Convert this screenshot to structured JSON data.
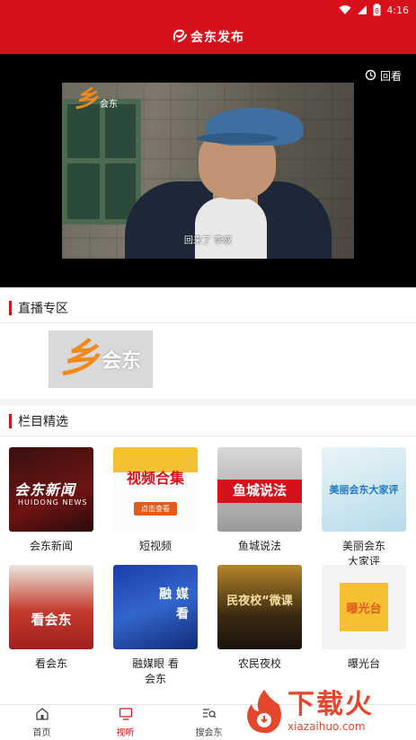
{
  "status_bar": {
    "time": "4:16",
    "battery_level": "8"
  },
  "header": {
    "title": "会东发布"
  },
  "player": {
    "replay_label": "回看",
    "channel_logo_text": "会东",
    "subtitle": "回来了  李叔"
  },
  "live_section": {
    "title": "直播专区",
    "channel_logo_text": "会东"
  },
  "programs_section": {
    "title": "栏目精选",
    "items": [
      {
        "label": "会东新闻",
        "thumb_text": "会东新闻",
        "thumb_sub": "HUIDONG NEWS"
      },
      {
        "label": "短视频",
        "thumb_text": "视频合集",
        "thumb_sub": "点击查看"
      },
      {
        "label": "鱼城说法",
        "thumb_text": "鱼城说法"
      },
      {
        "label": "美丽会东\n大家评",
        "thumb_text": "美丽会东大家评"
      },
      {
        "label": "看会东",
        "thumb_text": "看会东"
      },
      {
        "label": "融媒眼 看\n会东",
        "thumb_text": "融 媒\n看"
      },
      {
        "label": "农民夜校",
        "thumb_text": "民夜校“微课"
      },
      {
        "label": "曝光台",
        "thumb_text": "曝光台"
      }
    ]
  },
  "tab_bar": {
    "tabs": [
      {
        "label": "首页",
        "icon": "home-icon",
        "active": false
      },
      {
        "label": "视听",
        "icon": "tv-icon",
        "active": true
      },
      {
        "label": "搜会东",
        "icon": "search-list-icon",
        "active": false
      }
    ]
  },
  "watermark": {
    "big": "下载火",
    "small": "xiazaihuo.com"
  },
  "colors": {
    "brand_red": "#d7111b",
    "accent_orange": "#f08a1c"
  }
}
